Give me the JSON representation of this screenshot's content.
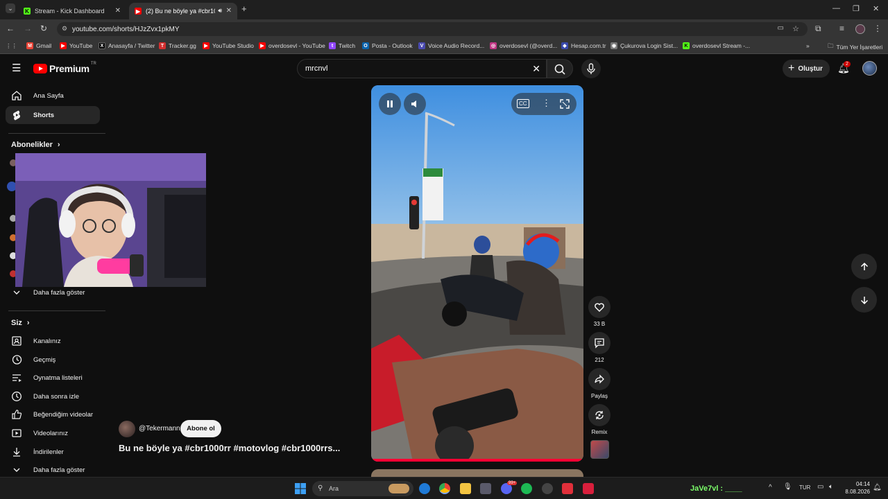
{
  "browser": {
    "tabs": [
      {
        "title": "Stream - Kick Dashboard",
        "favicon": "kick-icon"
      },
      {
        "title": "(2) Bu ne böyle ya #cbr100",
        "favicon": "youtube-icon",
        "active": true
      }
    ],
    "url": "youtube.com/shorts/HJzZvx1pkMY",
    "bookmarks": [
      "Gmail",
      "YouTube",
      "Anasayfa / Twitter",
      "Tracker.gg",
      "YouTube Studio",
      "overdosevl - YouTube",
      "Twitch",
      "Posta - Outlook",
      "Voice Audio Record...",
      "overdosevl (@overd...",
      "Hesap.com.tr",
      "Çukurova Login Sist...",
      "overdosevl Stream -..."
    ],
    "bookmarks_all": "Tüm Yer İşaretleri"
  },
  "youtube": {
    "logo_text": "Premium",
    "logo_region": "TR",
    "search_value": "mrcnvl",
    "create_label": "Oluştur",
    "notification_count": "2"
  },
  "sidebar": {
    "top": [
      {
        "label": "Ana Sayfa",
        "icon": "home-icon"
      },
      {
        "label": "Shorts",
        "icon": "shorts-icon",
        "selected": true
      }
    ],
    "subscriptions_header": "Abonelikler",
    "show_more_1": "Daha fazla göster",
    "you_header": "Siz",
    "you_items": [
      {
        "label": "Kanalınız",
        "icon": "channel-icon"
      },
      {
        "label": "Geçmiş",
        "icon": "history-icon"
      },
      {
        "label": "Oynatma listeleri",
        "icon": "playlists-icon"
      },
      {
        "label": "Daha sonra izle",
        "icon": "watch-later-icon"
      },
      {
        "label": "Beğendiğim videolar",
        "icon": "liked-icon"
      },
      {
        "label": "Videolarınız",
        "icon": "your-videos-icon"
      },
      {
        "label": "İndirilenler",
        "icon": "downloads-icon"
      }
    ],
    "show_more_2": "Daha fazla göster"
  },
  "short": {
    "channel": "@Tekermann",
    "subscribe_label": "Abone ol",
    "title": "Bu ne böyle ya #cbr1000rr #motovlog #cbr1000rrs...",
    "likes": "33 B",
    "comments": "212",
    "share_label": "Paylaş",
    "remix_label": "Remix",
    "progress": 1.0
  },
  "taskbar": {
    "search_placeholder": "Ara",
    "ticker": "JaVe7vl :",
    "lang": "TUR",
    "time": "04:14",
    "date": "8.08.2026",
    "badge_discord": "99+"
  },
  "colors": {
    "youtube_red": "#ff0000",
    "kick_green": "#53fc18",
    "accent_progress": "#ff0033"
  }
}
